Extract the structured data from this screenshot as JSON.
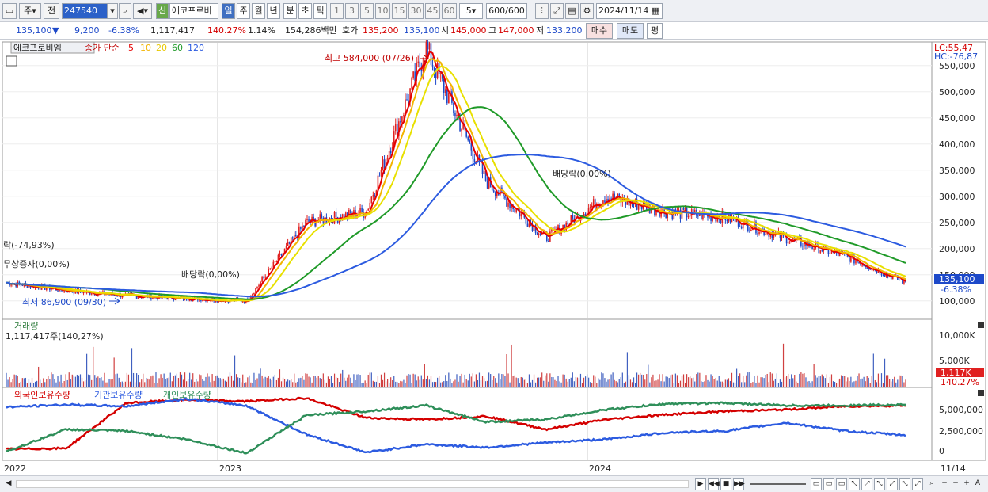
{
  "toolbar": {
    "period_unit": "주",
    "prev_label": "전",
    "code": "247540",
    "badge_new": "신",
    "stock_name": "에코프로비",
    "tab_day": "일",
    "tab_week": "주",
    "tab_month": "월",
    "tab_year": "년",
    "tab_minute": "분",
    "tab_second": "초",
    "tab_tick": "틱",
    "intervals": [
      "1",
      "3",
      "5",
      "10",
      "15",
      "30",
      "45",
      "60"
    ],
    "interval_value": "5",
    "count": "600",
    "count_total": "/600",
    "date": "2024/11/14"
  },
  "quote": {
    "price": "135,100",
    "arrow": "▼",
    "change": "9,200",
    "change_pct": "-6.38%",
    "volume": "1,117,417",
    "volume_ratio": "140.27%",
    "turnover": "1.14%",
    "amount": "154,286백만",
    "ask_label": "호가",
    "ask": "135,200",
    "bid": "135,100",
    "open_label": "시",
    "open": "145,000",
    "high_label": "고",
    "high": "147,000",
    "low_label": "저",
    "low": "133,200",
    "buy_label": "매수",
    "sell_label": "매도",
    "eval_label": "평"
  },
  "legend": {
    "name": "에코프로비엠",
    "ma_title": "종가 단순",
    "ma": [
      {
        "period": "5",
        "color": "#e60000"
      },
      {
        "period": "10",
        "color": "#f2b400"
      },
      {
        "period": "20",
        "color": "#e8e000"
      },
      {
        "period": "60",
        "color": "#1f9a28"
      },
      {
        "period": "120",
        "color": "#2c5be0"
      }
    ]
  },
  "right_info": {
    "lc": "LC:55,47",
    "hc": "HC:-76,87"
  },
  "annotations": {
    "high": "최고 584,000 (07/26)",
    "low": "최저 86,900 (09/30)",
    "dividend1": "배당락(0,00%)",
    "dividend2": "배당락(0,00%)",
    "rights": "락(-74,93%)",
    "rights2": "무상증자(0,00%)"
  },
  "price_axis": [
    "550,000",
    "500,000",
    "450,000",
    "400,000",
    "350,000",
    "300,000",
    "250,000",
    "200,000",
    "150,000",
    "100,000"
  ],
  "price_tag": {
    "value": "135,100",
    "pct": "-6.38%"
  },
  "volume_panel": {
    "title": "거래량",
    "value": "1,117,417주(140,27%)",
    "axis": [
      "10,000K",
      "5,000K"
    ],
    "tag_value": "1,117K",
    "tag_pct": "140.27%"
  },
  "holding_panel": {
    "series": [
      {
        "name": "외국인보유수량",
        "color": "#d40000"
      },
      {
        "name": "기관보유수량",
        "color": "#2c5be0"
      },
      {
        "name": "개인보유수량",
        "color": "#2f8f5a"
      }
    ],
    "axis": [
      "5,000,000",
      "2,500,000",
      "0"
    ]
  },
  "time_axis": [
    "2022",
    "2023",
    "2024",
    "11/14"
  ],
  "chart_data": {
    "type": "line",
    "x": [
      "2022-01",
      "2022-04",
      "2022-07",
      "2022-10",
      "2023-01",
      "2023-03",
      "2023-05",
      "2023-07",
      "2023-08",
      "2023-10",
      "2023-12",
      "2024-02",
      "2024-04",
      "2024-06",
      "2024-08",
      "2024-11"
    ],
    "series": [
      {
        "name": "종가",
        "values": [
          135000,
          120000,
          110000,
          105000,
          100000,
          250000,
          270000,
          584000,
          330000,
          220000,
          300000,
          270000,
          260000,
          220000,
          185000,
          135100
        ]
      }
    ],
    "ylim": [
      80000,
      580000
    ]
  }
}
